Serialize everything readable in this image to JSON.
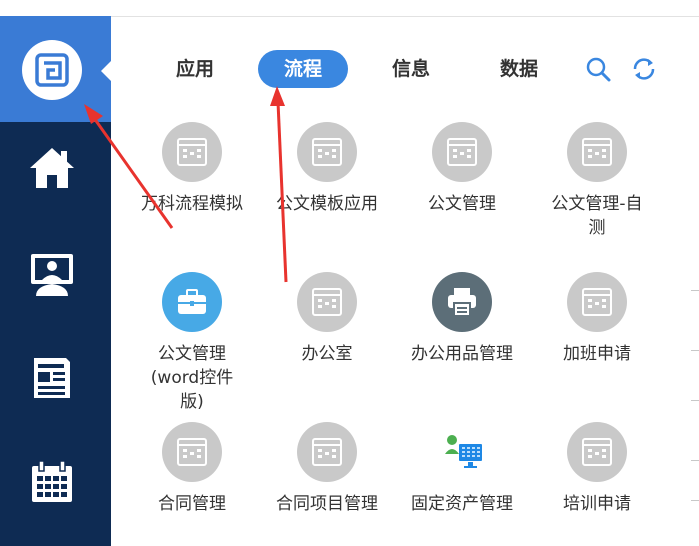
{
  "tabs": [
    {
      "label": "应用",
      "active": false
    },
    {
      "label": "流程",
      "active": true
    },
    {
      "label": "信息",
      "active": false
    },
    {
      "label": "数据",
      "active": false
    }
  ],
  "toolbar": {
    "search_icon": "search-icon",
    "refresh_icon": "refresh-icon"
  },
  "sidebar": {
    "items": [
      {
        "icon": "home-icon"
      },
      {
        "icon": "desktop-user-icon"
      },
      {
        "icon": "news-icon"
      },
      {
        "icon": "calendar-icon"
      }
    ]
  },
  "apps": [
    {
      "label": "万科流程模拟",
      "icon": "form-icon"
    },
    {
      "label": "公文模板应用",
      "icon": "form-icon"
    },
    {
      "label": "公文管理",
      "icon": "form-icon"
    },
    {
      "label": "公文管理-自测",
      "icon": "form-icon"
    },
    {
      "label": "公文管理(word控件版)",
      "icon": "briefcase-icon"
    },
    {
      "label": "办公室",
      "icon": "form-icon"
    },
    {
      "label": "办公用品管理",
      "icon": "printer-icon"
    },
    {
      "label": "加班申请",
      "icon": "form-icon"
    },
    {
      "label": "合同管理",
      "icon": "form-icon"
    },
    {
      "label": "合同项目管理",
      "icon": "form-icon"
    },
    {
      "label": "固定资产管理",
      "icon": "asset-monitor-icon"
    },
    {
      "label": "培训申请",
      "icon": "form-icon"
    }
  ],
  "colors": {
    "sidebar": "#0e2b53",
    "accent": "#3a87e0",
    "arrow": "#e8332e",
    "icon_gray": "#c9c9c9"
  }
}
